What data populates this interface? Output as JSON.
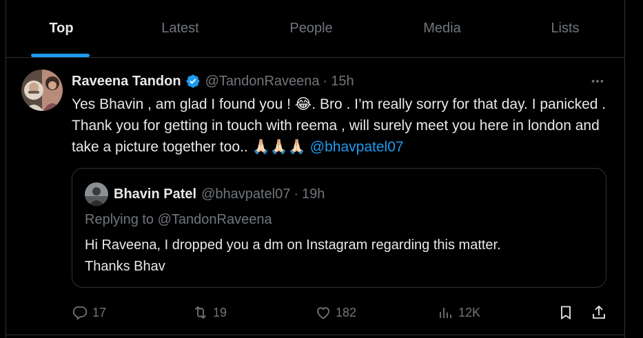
{
  "tabs": [
    {
      "label": "Top",
      "active": true
    },
    {
      "label": "Latest",
      "active": false
    },
    {
      "label": "People",
      "active": false
    },
    {
      "label": "Media",
      "active": false
    },
    {
      "label": "Lists",
      "active": false
    }
  ],
  "tweet": {
    "author_name": "Raveena Tandon",
    "handle": "@TandonRaveena",
    "separator": "·",
    "time": "15h",
    "more_icon": "more-icon",
    "text_part1": "Yes Bhavin , am glad I found you ! ",
    "emoji1": "😂",
    "text_part2": ". Bro . I’m really sorry for that day. I panicked . Thank you for getting in touch with reema , will surely meet you here in london and take a picture together too.. ",
    "emoji2": "🙏🏻🙏🏻🙏🏻",
    "mention": "@bhavpatel07",
    "quote": {
      "author_name": "Bhavin Patel",
      "handle": "@bhavpatel07",
      "separator": "·",
      "time": "19h",
      "replying_to": "Replying to @TandonRaveena",
      "text_line1": "Hi Raveena, I dropped you a dm on Instagram regarding this matter.",
      "text_line2": "Thanks Bhav"
    },
    "actions": {
      "replies": "17",
      "reposts": "19",
      "likes": "182",
      "views": "12K"
    }
  },
  "colors": {
    "background": "#000000",
    "text": "#e7e9ea",
    "muted": "#71767b",
    "accent": "#1d9bf0",
    "border": "#2f3336"
  }
}
